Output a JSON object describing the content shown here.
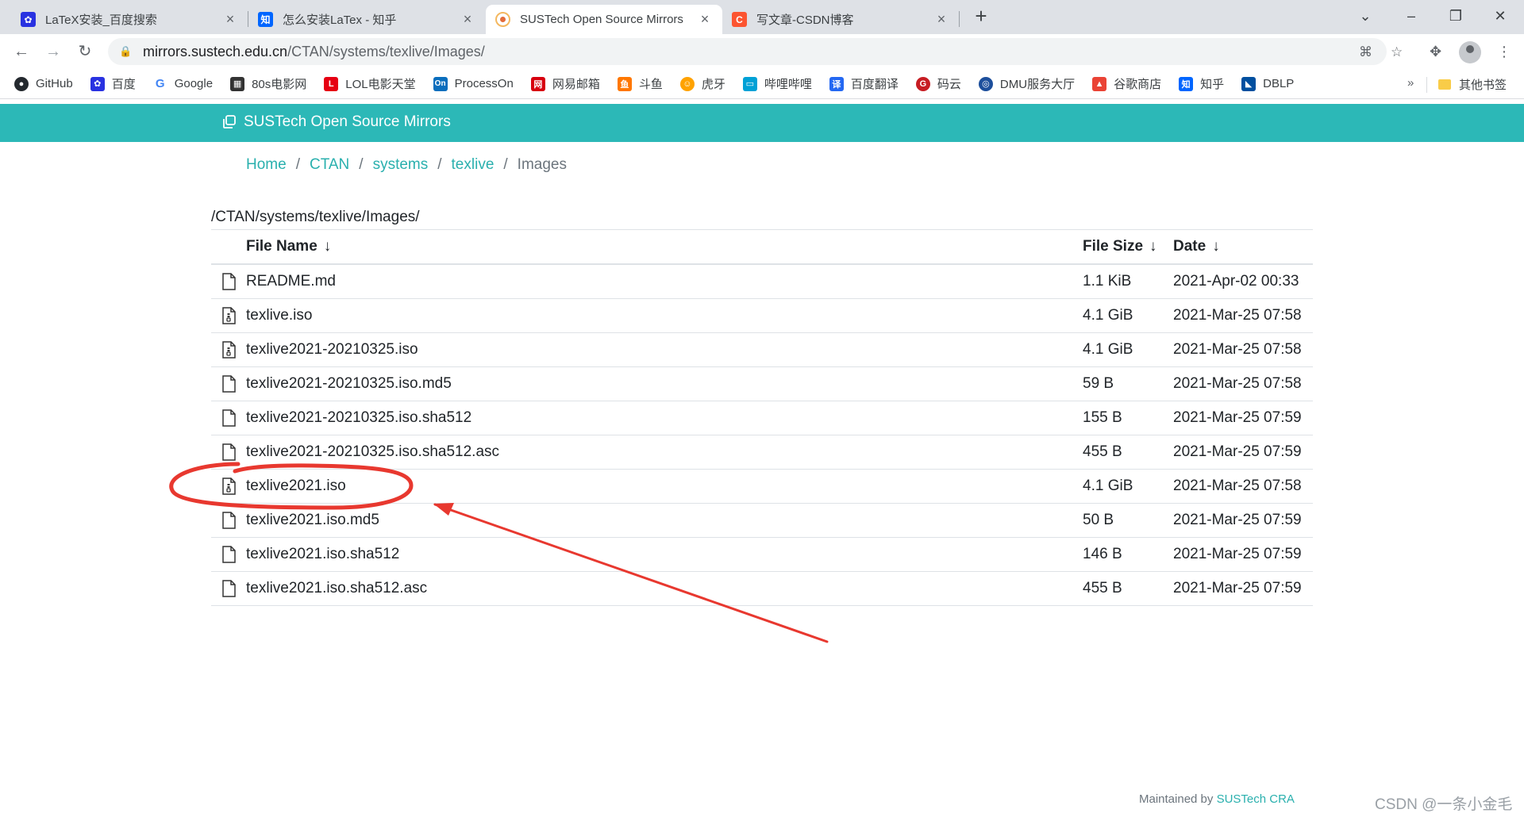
{
  "browser": {
    "tabs": [
      {
        "title": "LaTeX安装_百度搜索",
        "icon": "baidu-paw-icon",
        "color": "#2932e1"
      },
      {
        "title": "怎么安装LaTex - 知乎",
        "icon": "zhihu-icon",
        "color": "#0066ff"
      },
      {
        "title": "SUSTech Open Source Mirrors",
        "icon": "sustech-icon",
        "color": "#f4b860"
      },
      {
        "title": "写文章-CSDN博客",
        "icon": "csdn-icon",
        "color": "#fc5531"
      }
    ],
    "active_tab": 2,
    "address": {
      "host": "mirrors.sustech.edu.cn",
      "path": "/CTAN/systems/texlive/Images/"
    },
    "bookmarks": [
      {
        "label": "GitHub",
        "icon": "github-icon",
        "color": "#24292e"
      },
      {
        "label": "百度",
        "icon": "baidu-paw-icon",
        "color": "#2932e1"
      },
      {
        "label": "Google",
        "icon": "google-icon",
        "color": "#4285f4"
      },
      {
        "label": "80s电影网",
        "icon": "film-icon",
        "color": "#333333"
      },
      {
        "label": "LOL电影天堂",
        "icon": "lol-icon",
        "color": "#e60012"
      },
      {
        "label": "ProcessOn",
        "icon": "processon-icon",
        "color": "#0a6ebd"
      },
      {
        "label": "网易邮箱",
        "icon": "netease-icon",
        "color": "#d7000f"
      },
      {
        "label": "斗鱼",
        "icon": "douyu-icon",
        "color": "#ff7700"
      },
      {
        "label": "虎牙",
        "icon": "huya-icon",
        "color": "#ffa200"
      },
      {
        "label": "哔哩哔哩",
        "icon": "bilibili-icon",
        "color": "#00a1d6"
      },
      {
        "label": "百度翻译",
        "icon": "translate-icon",
        "color": "#2468f2"
      },
      {
        "label": "码云",
        "icon": "gitee-icon",
        "color": "#c71d23"
      },
      {
        "label": "DMU服务大厅",
        "icon": "dmu-icon",
        "color": "#1d4f9c"
      },
      {
        "label": "谷歌商店",
        "icon": "webstore-icon",
        "color": "#ea4335"
      },
      {
        "label": "知乎",
        "icon": "zhihu-icon",
        "color": "#0066ff"
      },
      {
        "label": "DBLP",
        "icon": "dblp-icon",
        "color": "#004f9f"
      }
    ],
    "more_bookmarks": "»",
    "other_bookmarks": "其他书签"
  },
  "site": {
    "brand": "SUSTech Open Source Mirrors",
    "accent": "#2cb8b7"
  },
  "breadcrumb": [
    {
      "label": "Home",
      "link": true
    },
    {
      "label": "CTAN",
      "link": true
    },
    {
      "label": "systems",
      "link": true
    },
    {
      "label": "texlive",
      "link": true
    },
    {
      "label": "Images",
      "link": false
    }
  ],
  "listing": {
    "path": "/CTAN/systems/texlive/Images/",
    "columns": {
      "name": "File Name",
      "size": "File Size",
      "date": "Date",
      "sort_arrow": "↓"
    },
    "files": [
      {
        "name": "README.md",
        "size": "1.1 KiB",
        "date": "2021-Apr-02 00:33",
        "icon": "file-icon"
      },
      {
        "name": "texlive.iso",
        "size": "4.1 GiB",
        "date": "2021-Mar-25 07:58",
        "icon": "archive-file-icon"
      },
      {
        "name": "texlive2021-20210325.iso",
        "size": "4.1 GiB",
        "date": "2021-Mar-25 07:58",
        "icon": "archive-file-icon"
      },
      {
        "name": "texlive2021-20210325.iso.md5",
        "size": "59 B",
        "date": "2021-Mar-25 07:58",
        "icon": "file-icon"
      },
      {
        "name": "texlive2021-20210325.iso.sha512",
        "size": "155 B",
        "date": "2021-Mar-25 07:59",
        "icon": "file-icon"
      },
      {
        "name": "texlive2021-20210325.iso.sha512.asc",
        "size": "455 B",
        "date": "2021-Mar-25 07:59",
        "icon": "file-icon"
      },
      {
        "name": "texlive2021.iso",
        "size": "4.1 GiB",
        "date": "2021-Mar-25 07:58",
        "icon": "archive-file-icon"
      },
      {
        "name": "texlive2021.iso.md5",
        "size": "50 B",
        "date": "2021-Mar-25 07:59",
        "icon": "file-icon"
      },
      {
        "name": "texlive2021.iso.sha512",
        "size": "146 B",
        "date": "2021-Mar-25 07:59",
        "icon": "file-icon"
      },
      {
        "name": "texlive2021.iso.sha512.asc",
        "size": "455 B",
        "date": "2021-Mar-25 07:59",
        "icon": "file-icon"
      }
    ]
  },
  "footer": {
    "prefix": "Maintained by ",
    "link": "SUSTech CRA"
  },
  "watermark": "CSDN @一条小金毛",
  "annotation_color": "#e8382f"
}
